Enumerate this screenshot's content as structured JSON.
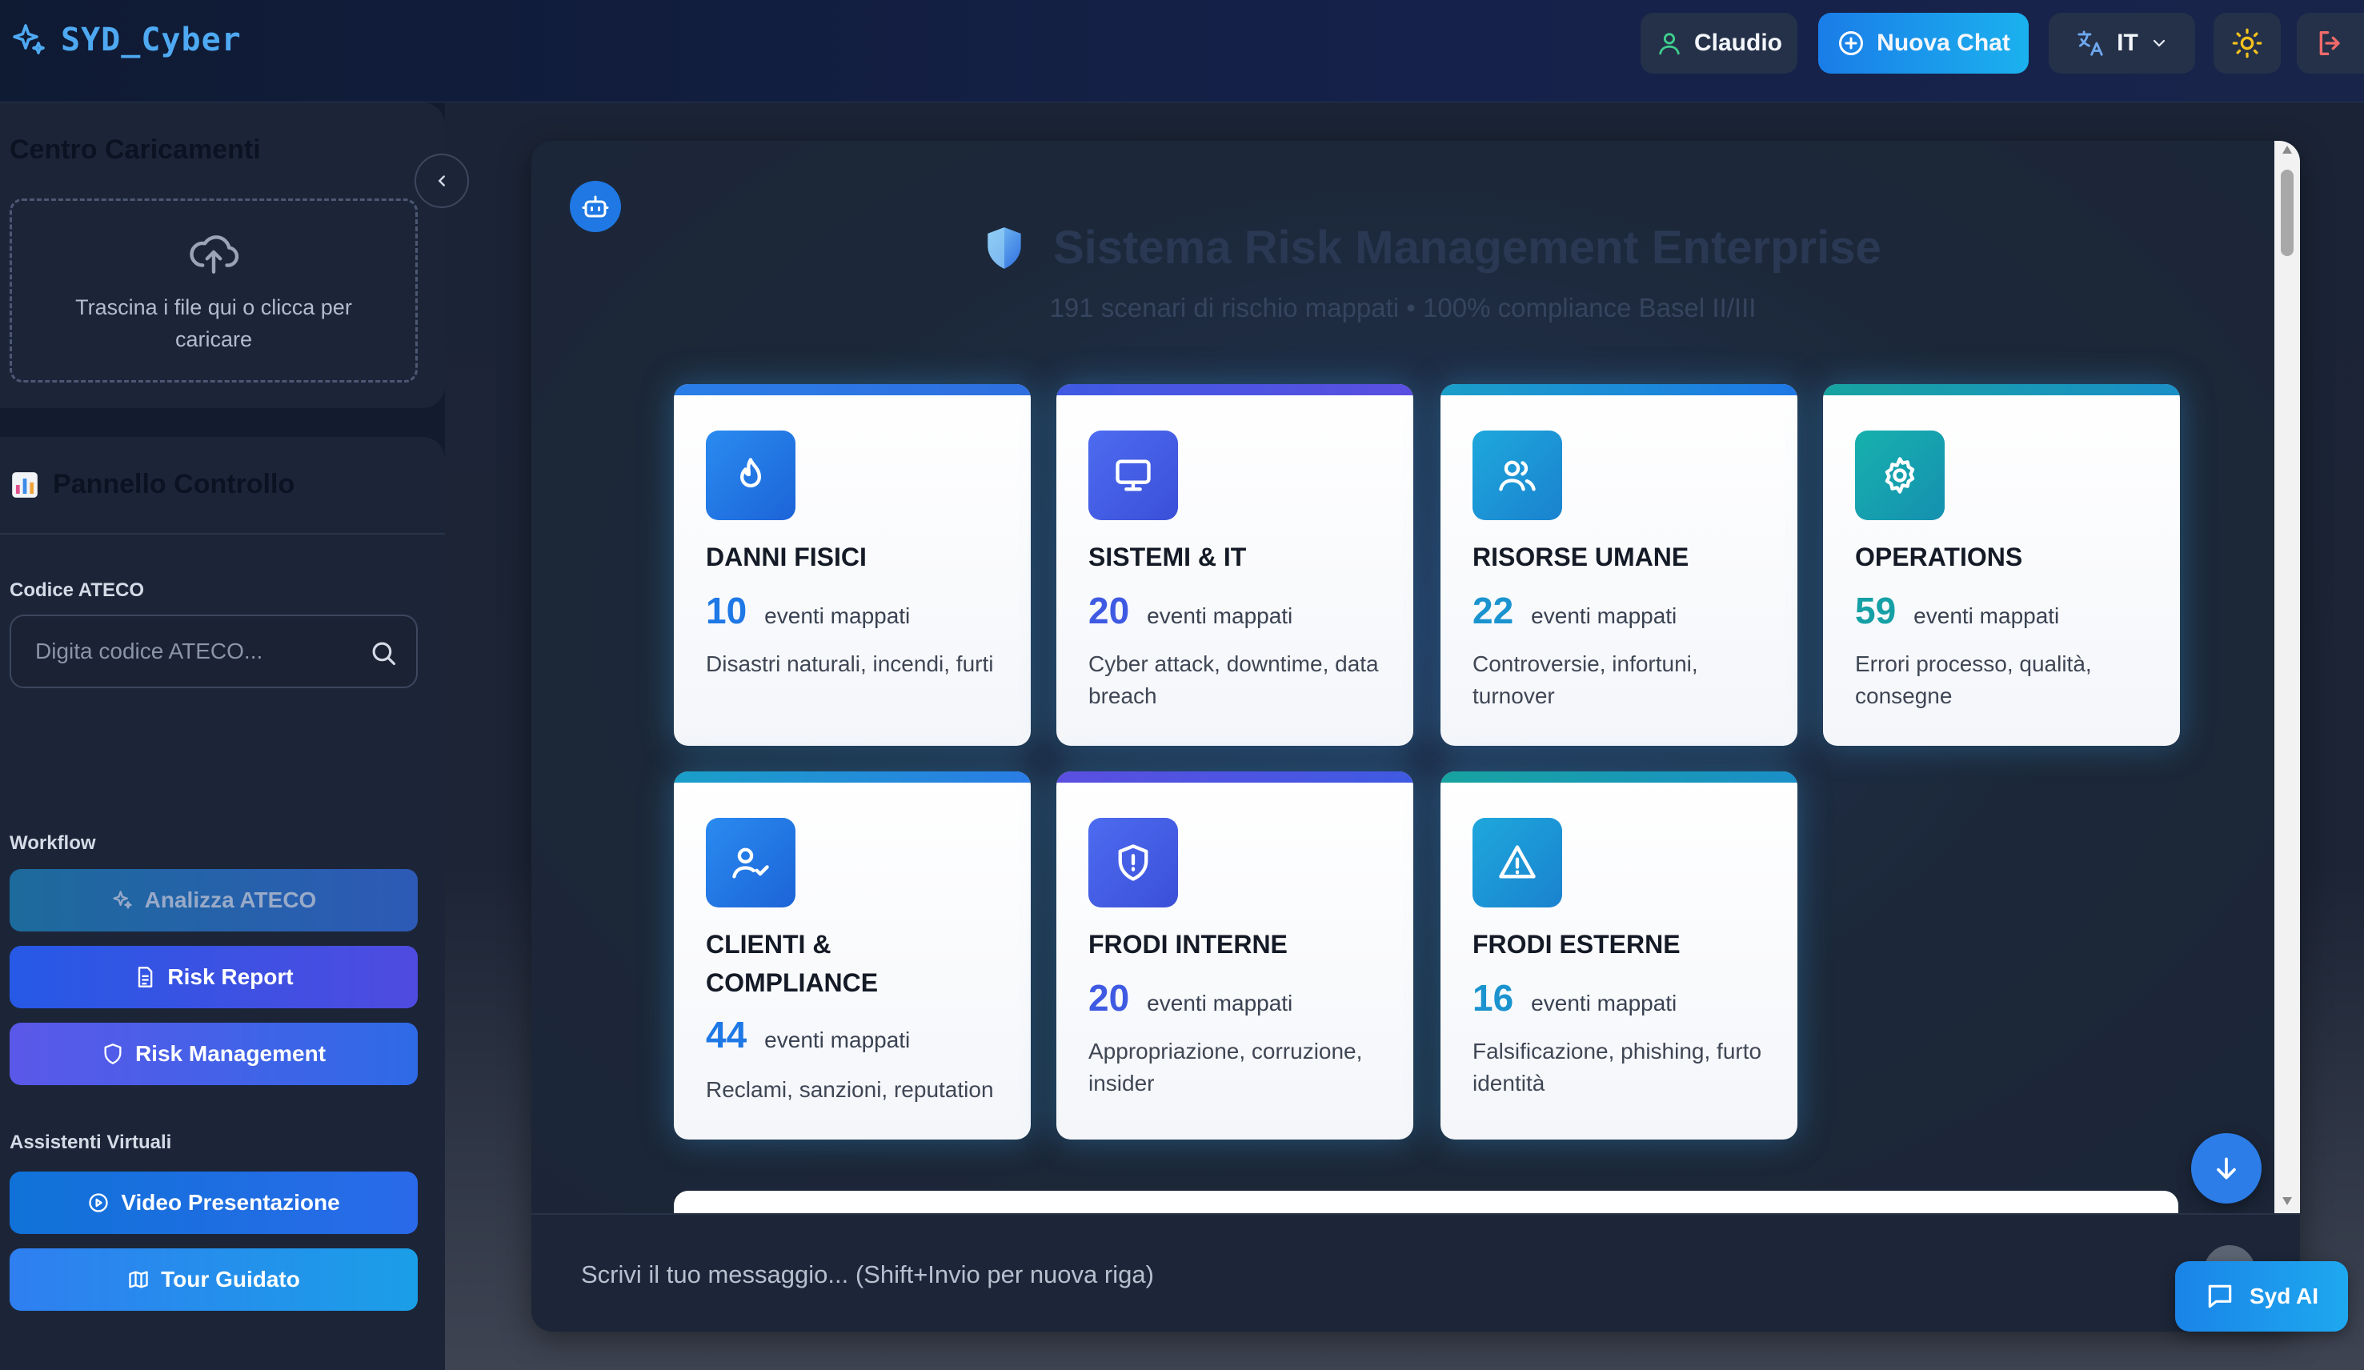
{
  "app": {
    "name": "SYD_Cyber"
  },
  "header": {
    "user_label": "Claudio",
    "new_chat_label": "Nuova Chat",
    "language_label": "IT"
  },
  "sidebar": {
    "upload": {
      "title": "Centro Caricamenti",
      "dropzone_text": "Trascina i file qui o clicca per caricare"
    },
    "control": {
      "title": "Pannello Controllo",
      "ateco_label": "Codice ATECO",
      "ateco_placeholder": "Digita codice ATECO...",
      "workflow_label": "Workflow",
      "buttons": {
        "analizza": "Analizza ATECO",
        "risk_report": "Risk Report",
        "risk_management": "Risk Management"
      },
      "assistants_label": "Assistenti Virtuali",
      "assistants": {
        "video": "Video Presentazione",
        "tour": "Tour Guidato"
      }
    }
  },
  "main": {
    "title": "Sistema Risk Management Enterprise",
    "subtitle": "191 scenari di rischio mappati • 100% compliance Basel II/III",
    "events_label": "eventi mappati",
    "categories": [
      {
        "name": "DANNI FISICI",
        "count": "10",
        "desc": "Disastri naturali, incendi, furti",
        "icon": "flame-icon",
        "color": "#1e78e6"
      },
      {
        "name": "SISTEMI & IT",
        "count": "20",
        "desc": "Cyber attack, downtime, data breach",
        "icon": "monitor-icon",
        "color": "#3f5ae2"
      },
      {
        "name": "RISORSE UMANE",
        "count": "22",
        "desc": "Controversie, infortuni, turnover",
        "icon": "users-icon",
        "color": "#1a93cf"
      },
      {
        "name": "OPERATIONS",
        "count": "59",
        "desc": "Errori processo, qualità, consegne",
        "icon": "gear-icon",
        "color": "#15a0a6"
      },
      {
        "name": "CLIENTI & COMPLIANCE",
        "count": "44",
        "desc": "Reclami, sanzioni, reputation",
        "icon": "user-check-icon",
        "color": "#1e78e6"
      },
      {
        "name": "FRODI INTERNE",
        "count": "20",
        "desc": "Appropriazione, corruzione, insider",
        "icon": "shield-alert-icon",
        "color": "#3f5ae2"
      },
      {
        "name": "FRODI ESTERNE",
        "count": "16",
        "desc": "Falsificazione, phishing, furto identità",
        "icon": "warning-icon",
        "color": "#1a93cf"
      }
    ]
  },
  "chat_input": {
    "placeholder": "Scrivi il tuo messaggio... (Shift+Invio per nuova riga)"
  },
  "assistant_fab": {
    "label": "Syd AI"
  }
}
